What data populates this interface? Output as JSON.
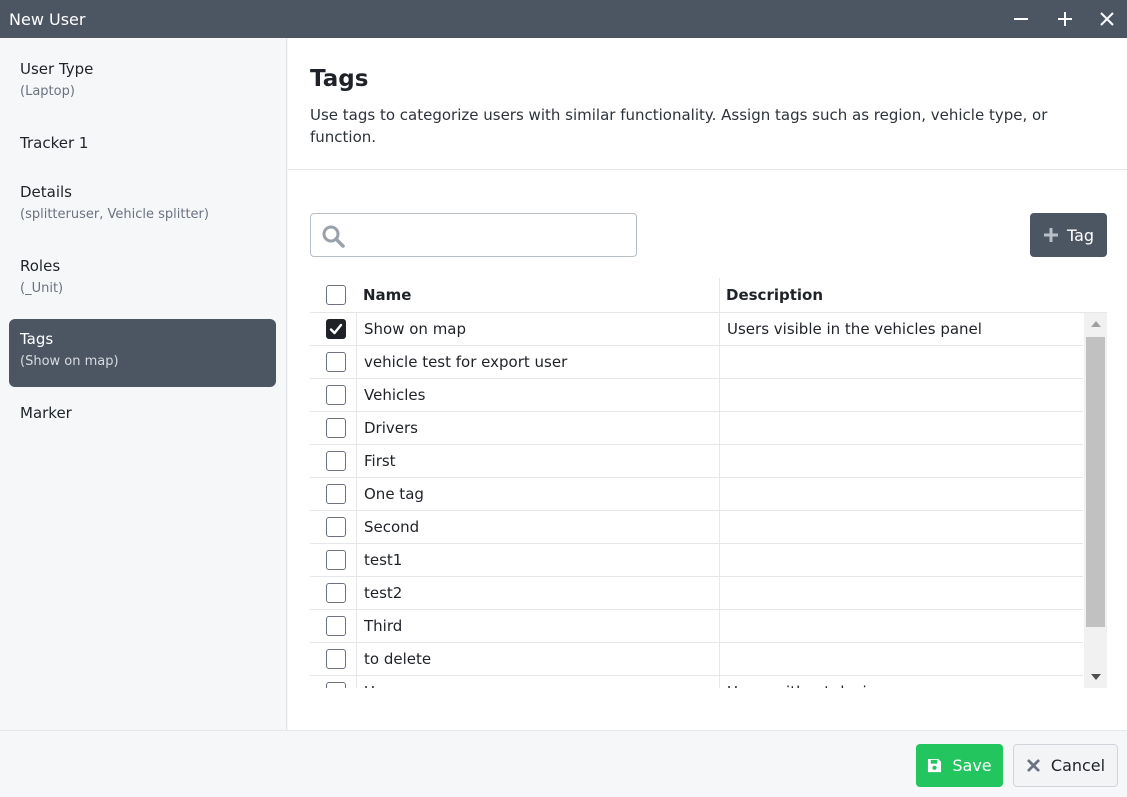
{
  "window": {
    "title": "New User",
    "minimize_icon": "minus-icon",
    "maximize_icon": "plus-icon",
    "close_icon": "close-icon"
  },
  "sidebar": {
    "items": [
      {
        "label": "User Type",
        "sub": "(Laptop)"
      },
      {
        "label": "Tracker 1",
        "sub": ""
      },
      {
        "label": "Details",
        "sub": "(splitteruser, Vehicle splitter)"
      },
      {
        "label": "Roles",
        "sub": "(_Unit)"
      },
      {
        "label": "Tags",
        "sub": "(Show on map)"
      },
      {
        "label": "Marker",
        "sub": ""
      }
    ],
    "active_index": 4
  },
  "main": {
    "title": "Tags",
    "description": "Use tags to categorize users with similar functionality. Assign tags such as region, vehicle type, or function.",
    "search": {
      "placeholder": "",
      "value": ""
    },
    "add_tag_label": "Tag"
  },
  "table": {
    "columns": {
      "name": "Name",
      "description": "Description"
    },
    "rows": [
      {
        "name": "Show on map",
        "description": "Users visible in the vehicles panel",
        "checked": true
      },
      {
        "name": "vehicle test for export user",
        "description": "",
        "checked": false
      },
      {
        "name": "Vehicles",
        "description": "",
        "checked": false
      },
      {
        "name": "Drivers",
        "description": "",
        "checked": false
      },
      {
        "name": "First",
        "description": "",
        "checked": false
      },
      {
        "name": "One tag",
        "description": "",
        "checked": false
      },
      {
        "name": "Second",
        "description": "",
        "checked": false
      },
      {
        "name": "test1",
        "description": "",
        "checked": false
      },
      {
        "name": "test2",
        "description": "",
        "checked": false
      },
      {
        "name": "Third",
        "description": "",
        "checked": false
      },
      {
        "name": "to delete",
        "description": "",
        "checked": false
      },
      {
        "name": "Users",
        "description": "Users without device",
        "checked": false
      }
    ]
  },
  "footer": {
    "save_label": "Save",
    "cancel_label": "Cancel"
  },
  "colors": {
    "titlebar": "#4c5663",
    "save": "#22c55e",
    "active_nav": "#4c5663"
  }
}
